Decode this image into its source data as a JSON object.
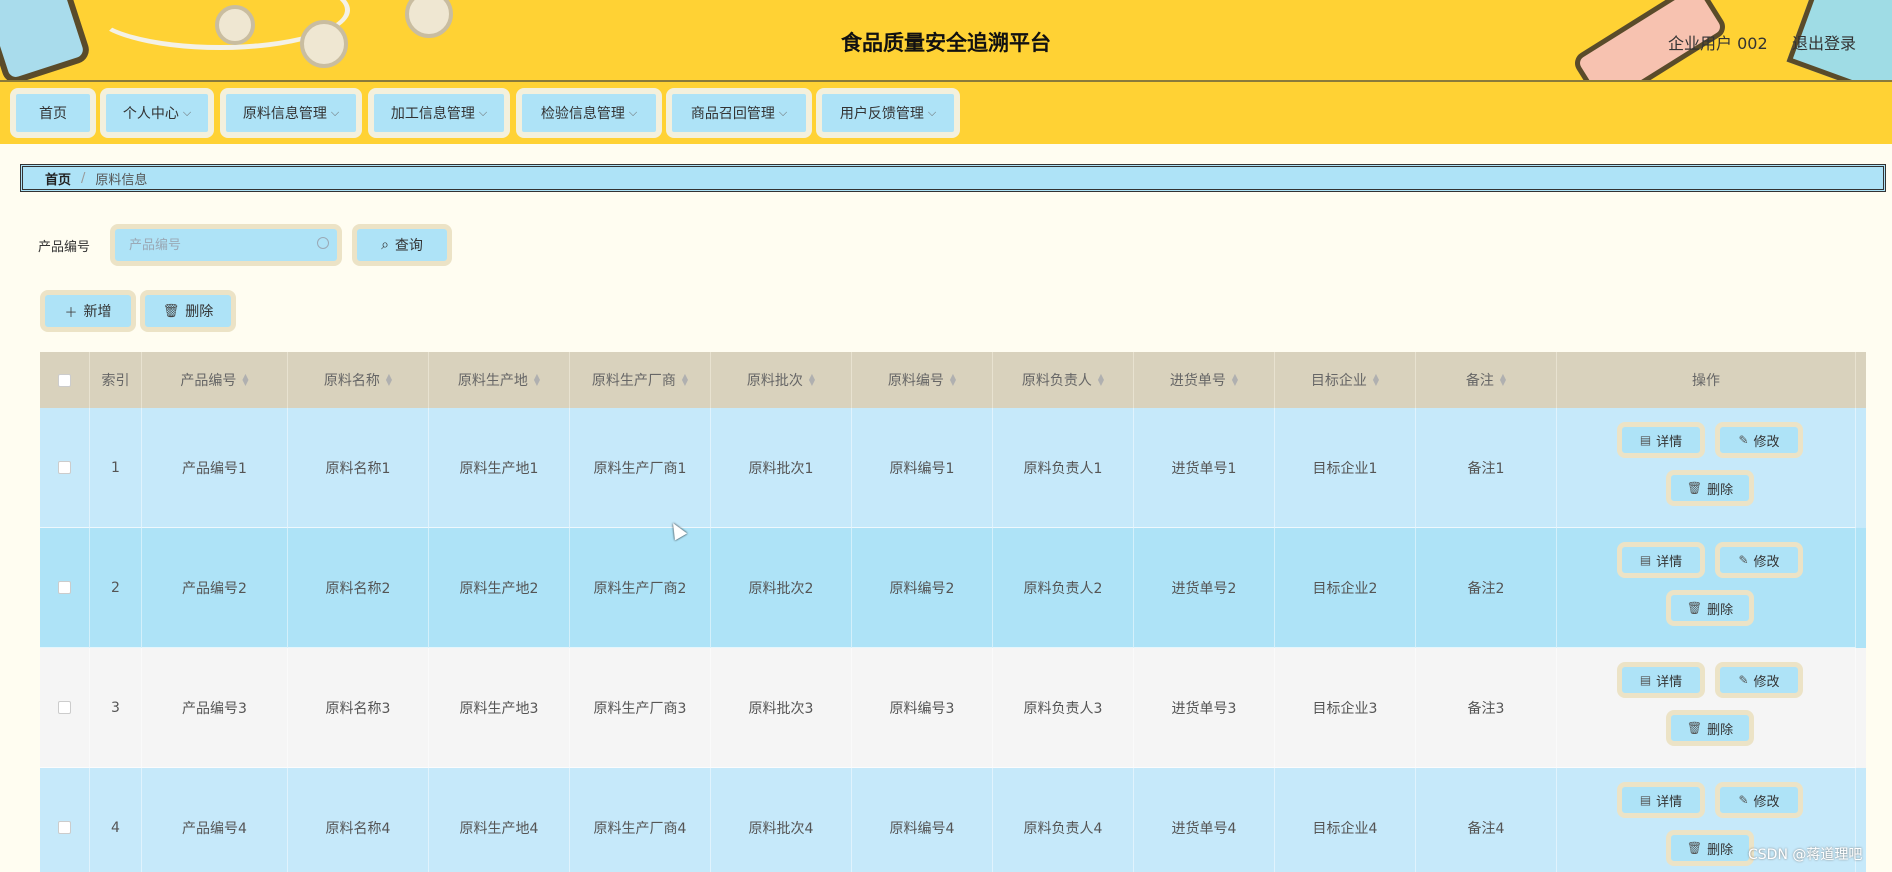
{
  "header": {
    "title": "食品质量安全追溯平台",
    "user": "企业用户 002",
    "logout": "退出登录"
  },
  "nav": {
    "items": [
      {
        "label": "首页",
        "dropdown": false
      },
      {
        "label": "个人中心",
        "dropdown": true
      },
      {
        "label": "原料信息管理",
        "dropdown": true
      },
      {
        "label": "加工信息管理",
        "dropdown": true
      },
      {
        "label": "检验信息管理",
        "dropdown": true
      },
      {
        "label": "商品召回管理",
        "dropdown": true
      },
      {
        "label": "用户反馈管理",
        "dropdown": true
      }
    ]
  },
  "breadcrumb": {
    "home": "首页",
    "separator": "/",
    "current": "原料信息"
  },
  "search": {
    "label": "产品编号",
    "placeholder": "产品编号",
    "button": "查询"
  },
  "actions": {
    "add": "新增",
    "delete": "删除"
  },
  "table": {
    "columns": [
      "索引",
      "产品编号",
      "原料名称",
      "原料生产地",
      "原料生产厂商",
      "原料批次",
      "原料编号",
      "原料负责人",
      "进货单号",
      "目标企业",
      "备注",
      "操作"
    ],
    "rows": [
      {
        "index": "1",
        "cells": [
          "产品编号1",
          "原料名称1",
          "原料生产地1",
          "原料生产厂商1",
          "原料批次1",
          "原料编号1",
          "原料负责人1",
          "进货单号1",
          "目标企业1",
          "备注1"
        ]
      },
      {
        "index": "2",
        "cells": [
          "产品编号2",
          "原料名称2",
          "原料生产地2",
          "原料生产厂商2",
          "原料批次2",
          "原料编号2",
          "原料负责人2",
          "进货单号2",
          "目标企业2",
          "备注2"
        ]
      },
      {
        "index": "3",
        "cells": [
          "产品编号3",
          "原料名称3",
          "原料生产地3",
          "原料生产厂商3",
          "原料批次3",
          "原料编号3",
          "原料负责人3",
          "进货单号3",
          "目标企业3",
          "备注3"
        ]
      },
      {
        "index": "4",
        "cells": [
          "产品编号4",
          "原料名称4",
          "原料生产地4",
          "原料生产厂商4",
          "原料批次4",
          "原料编号4",
          "原料负责人4",
          "进货单号4",
          "目标企业4",
          "备注4"
        ]
      }
    ],
    "row_ops": {
      "detail": "详情",
      "edit": "修改",
      "delete": "删除"
    }
  },
  "watermark": "CSDN @蒋道理吧",
  "colors": {
    "header_bg": "#ffd234",
    "button_bg": "#aee3f7",
    "button_border": "#ece3c6",
    "table_head": "#d9d2bd",
    "page_bg": "#fffdf1"
  }
}
